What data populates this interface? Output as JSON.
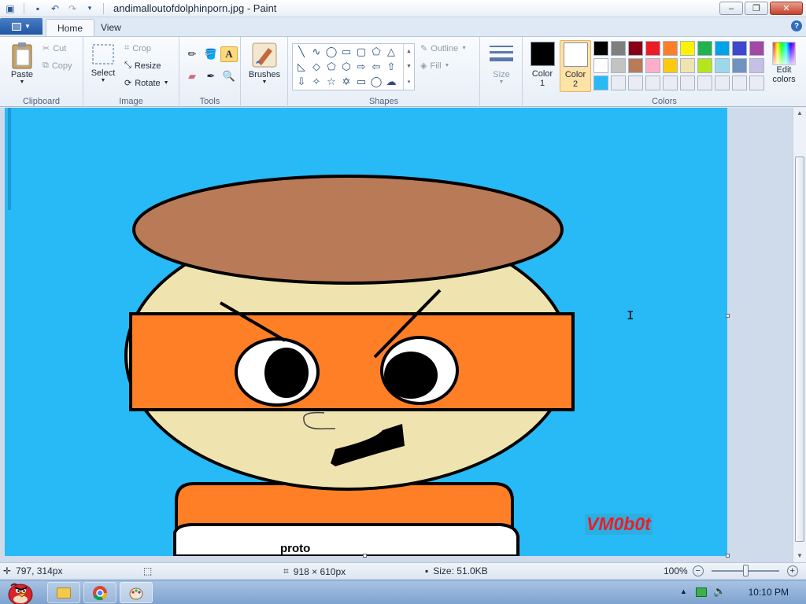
{
  "window": {
    "title": "andimalloutofdolphinporn.jpg - Paint",
    "minimize": "–",
    "maximize": "❐",
    "close": "✕"
  },
  "tabs": [
    {
      "label": "Home",
      "active": true
    },
    {
      "label": "View",
      "active": false
    }
  ],
  "help": "?",
  "ribbon": {
    "clipboard": {
      "label": "Clipboard",
      "paste": "Paste",
      "cut": "Cut",
      "copy": "Copy"
    },
    "image": {
      "label": "Image",
      "select": "Select",
      "crop": "Crop",
      "resize": "Resize",
      "rotate": "Rotate"
    },
    "tools": {
      "label": "Tools"
    },
    "brushes": {
      "label": "Brushes"
    },
    "shapes": {
      "label": "Shapes",
      "outline": "Outline",
      "fill": "Fill"
    },
    "size": {
      "label": "Size"
    },
    "colors": {
      "label": "Colors",
      "color1_label": "Color",
      "color1_num": "1",
      "color2_label": "Color",
      "color2_num": "2",
      "edit_label1": "Edit",
      "edit_label2": "colors",
      "color1": "#000000",
      "color2": "#ffffff",
      "palette_row1": [
        "#000000",
        "#7f7f7f",
        "#880015",
        "#ed1c24",
        "#ff7f27",
        "#fff200",
        "#22b14c",
        "#00a2e8",
        "#3f48cc",
        "#a349a4"
      ],
      "palette_row2": [
        "#ffffff",
        "#c3c3c3",
        "#b97a57",
        "#ffaec9",
        "#ffc90e",
        "#efe4b0",
        "#b5e61d",
        "#99d9ea",
        "#7092be",
        "#c8bfe7"
      ],
      "palette_row3": [
        "#27baf7",
        "#e9edf3",
        "#e9edf3",
        "#e9edf3",
        "#e9edf3",
        "#e9edf3",
        "#e9edf3",
        "#e9edf3",
        "#e9edf3",
        "#e9edf3"
      ]
    }
  },
  "canvas": {
    "background": "#27baf7",
    "shirt_text": "proto",
    "watermark": "VM0b0t"
  },
  "status": {
    "cursor_pos": "797, 314px",
    "image_size": "918 × 610px",
    "file_size": "Size: 51.0KB",
    "zoom": "100%"
  },
  "taskbar": {
    "time": "10:10 PM"
  }
}
